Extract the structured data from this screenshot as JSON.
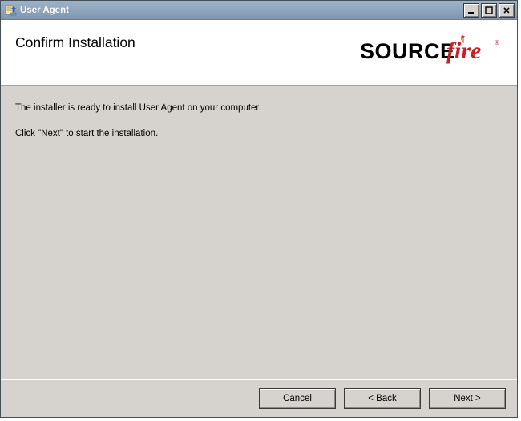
{
  "window": {
    "title": "User Agent"
  },
  "header": {
    "heading": "Confirm Installation",
    "logo": {
      "text_source": "SOURCE",
      "text_fire": "fire",
      "colors": {
        "source": "#000000",
        "fire": "#c92027",
        "flame": "#c92027"
      }
    }
  },
  "body": {
    "line1": "The installer is ready to install User Agent on your computer.",
    "line2": "Click \"Next\" to start the installation."
  },
  "footer": {
    "cancel": "Cancel",
    "back": "< Back",
    "next": "Next >"
  }
}
